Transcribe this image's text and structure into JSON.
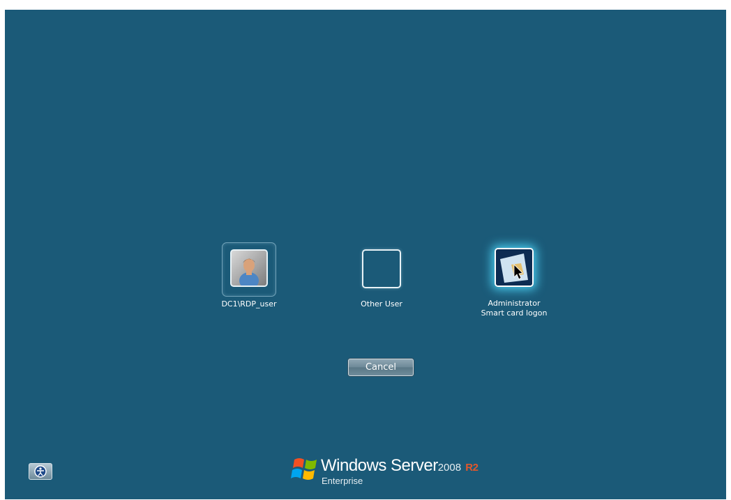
{
  "tiles": [
    {
      "label": "DC1\\RDP_user",
      "icon": "user-avatar-icon",
      "state": "selected"
    },
    {
      "label": "Other User",
      "icon": "blank-user-icon",
      "state": "normal"
    },
    {
      "label_line1": "Administrator",
      "label_line2": "Smart card logon",
      "icon": "smart-card-icon",
      "state": "highlighted"
    }
  ],
  "cancel_label": "Cancel",
  "ease_of_access_icon": "ease-of-access-icon",
  "branding": {
    "logo_icon": "windows-flag-logo",
    "product": "Windows Server",
    "version": "2008",
    "release": "R2",
    "edition": "Enterprise"
  },
  "colors": {
    "background": "#1b5a78",
    "glow": "#50dcff",
    "r2": "#e2572b"
  }
}
